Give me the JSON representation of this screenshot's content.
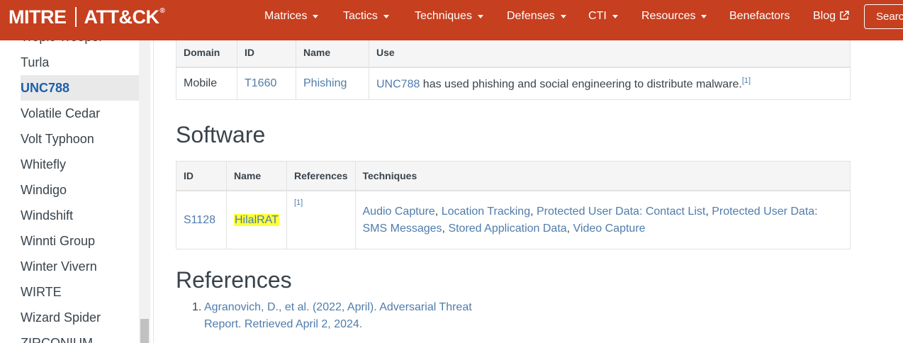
{
  "nav": {
    "logo_left": "MITRE",
    "logo_right": "ATT&CK",
    "logo_mark": "®",
    "items": [
      {
        "label": "Matrices",
        "dropdown": true
      },
      {
        "label": "Tactics",
        "dropdown": true
      },
      {
        "label": "Techniques",
        "dropdown": true
      },
      {
        "label": "Defenses",
        "dropdown": true
      },
      {
        "label": "CTI",
        "dropdown": true
      },
      {
        "label": "Resources",
        "dropdown": true
      },
      {
        "label": "Benefactors",
        "dropdown": false
      },
      {
        "label": "Blog",
        "external_icon": "external-link-icon"
      }
    ],
    "search_placeholder": "Search"
  },
  "sidebar": {
    "items": [
      "Tropic Trooper",
      "Turla",
      "UNC788",
      "Volatile Cedar",
      "Volt Typhoon",
      "Whitefly",
      "Windigo",
      "Windshift",
      "Winnti Group",
      "Winter Vivern",
      "WIRTE",
      "Wizard Spider",
      "ZIRCONIUM"
    ],
    "active": "UNC788"
  },
  "techniques_table": {
    "headers": [
      "Domain",
      "ID",
      "Name",
      "Use"
    ],
    "rows": [
      {
        "domain": "Mobile",
        "id": "T1660",
        "name": "Phishing",
        "use_link": "UNC788",
        "use_text": " has used phishing and social engineering to distribute malware.",
        "ref": "[1]"
      }
    ]
  },
  "software": {
    "heading": "Software",
    "headers": [
      "ID",
      "Name",
      "References",
      "Techniques"
    ],
    "rows": [
      {
        "id": "S1128",
        "name": "HilalRAT",
        "ref": "[1]",
        "techniques": [
          "Audio Capture",
          "Location Tracking",
          "Protected User Data: Contact List",
          "Protected User Data: SMS Messages",
          "Stored Application Data",
          "Video Capture"
        ]
      }
    ]
  },
  "references": {
    "heading": "References",
    "items": [
      "Agranovich, D., et al. (2022, April). Adversarial Threat Report. Retrieved April 2, 2024."
    ]
  },
  "colors": {
    "brand": "#c63f1f",
    "link": "#4f7cac",
    "active": "#1c5fa8",
    "highlight": "#ffff3a"
  }
}
